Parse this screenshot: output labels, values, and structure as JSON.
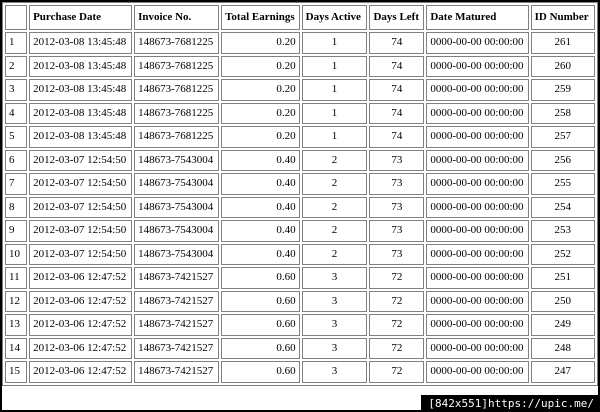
{
  "table": {
    "headers": [
      "",
      "Purchase Date",
      "Invoice No.",
      "Total Earnings",
      "Days Active",
      "Days Left",
      "Date Matured",
      "ID Number"
    ],
    "rows": [
      [
        "1",
        "2012-03-08 13:45:48",
        "148673-7681225",
        "0.20",
        "1",
        "74",
        "0000-00-00 00:00:00",
        "261"
      ],
      [
        "2",
        "2012-03-08 13:45:48",
        "148673-7681225",
        "0.20",
        "1",
        "74",
        "0000-00-00 00:00:00",
        "260"
      ],
      [
        "3",
        "2012-03-08 13:45:48",
        "148673-7681225",
        "0.20",
        "1",
        "74",
        "0000-00-00 00:00:00",
        "259"
      ],
      [
        "4",
        "2012-03-08 13:45:48",
        "148673-7681225",
        "0.20",
        "1",
        "74",
        "0000-00-00 00:00:00",
        "258"
      ],
      [
        "5",
        "2012-03-08 13:45:48",
        "148673-7681225",
        "0.20",
        "1",
        "74",
        "0000-00-00 00:00:00",
        "257"
      ],
      [
        "6",
        "2012-03-07 12:54:50",
        "148673-7543004",
        "0.40",
        "2",
        "73",
        "0000-00-00 00:00:00",
        "256"
      ],
      [
        "7",
        "2012-03-07 12:54:50",
        "148673-7543004",
        "0.40",
        "2",
        "73",
        "0000-00-00 00:00:00",
        "255"
      ],
      [
        "8",
        "2012-03-07 12:54:50",
        "148673-7543004",
        "0.40",
        "2",
        "73",
        "0000-00-00 00:00:00",
        "254"
      ],
      [
        "9",
        "2012-03-07 12:54:50",
        "148673-7543004",
        "0.40",
        "2",
        "73",
        "0000-00-00 00:00:00",
        "253"
      ],
      [
        "10",
        "2012-03-07 12:54:50",
        "148673-7543004",
        "0.40",
        "2",
        "73",
        "0000-00-00 00:00:00",
        "252"
      ],
      [
        "11",
        "2012-03-06 12:47:52",
        "148673-7421527",
        "0.60",
        "3",
        "72",
        "0000-00-00 00:00:00",
        "251"
      ],
      [
        "12",
        "2012-03-06 12:47:52",
        "148673-7421527",
        "0.60",
        "3",
        "72",
        "0000-00-00 00:00:00",
        "250"
      ],
      [
        "13",
        "2012-03-06 12:47:52",
        "148673-7421527",
        "0.60",
        "3",
        "72",
        "0000-00-00 00:00:00",
        "249"
      ],
      [
        "14",
        "2012-03-06 12:47:52",
        "148673-7421527",
        "0.60",
        "3",
        "72",
        "0000-00-00 00:00:00",
        "248"
      ],
      [
        "15",
        "2012-03-06 12:47:52",
        "148673-7421527",
        "0.60",
        "3",
        "72",
        "0000-00-00 00:00:00",
        "247"
      ]
    ]
  },
  "watermark": {
    "text": "[842x551]https://upic.me/"
  },
  "colors": {
    "background": "#000000",
    "sheet": "#ffffff",
    "border": "#808080",
    "text": "#000000"
  }
}
